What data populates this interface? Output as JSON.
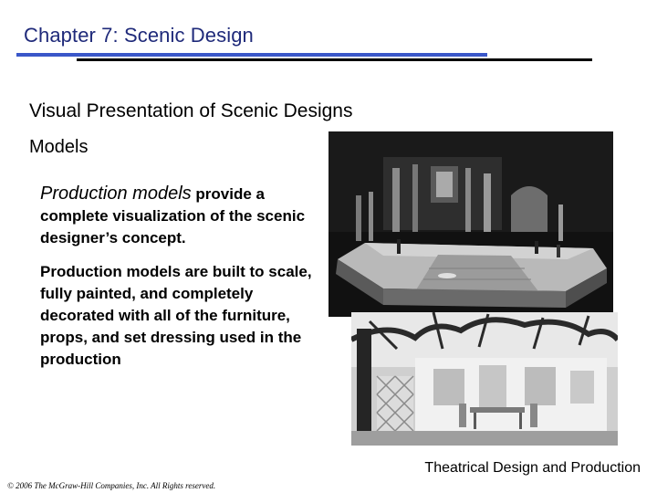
{
  "header": {
    "chapter_title": "Chapter 7:  Scenic Design"
  },
  "slide": {
    "heading": "Visual Presentation of Scenic Designs",
    "subheading": "Models",
    "para1_lead": "Production models",
    "para1_rest": " provide a complete visualization of the scenic designer’s concept.",
    "para2": "Production models are built to scale, fully painted, and completely decorated with all of the furniture, props, and set dressing used in the production"
  },
  "footer": {
    "book_title": "Theatrical Design and Production",
    "copyright": "© 2006 The McGraw-Hill Companies, Inc. All Rights reserved."
  },
  "colors": {
    "title_blue": "#1f2a7a",
    "rule_blue": "#3a57c9",
    "rule_black": "#000000"
  }
}
